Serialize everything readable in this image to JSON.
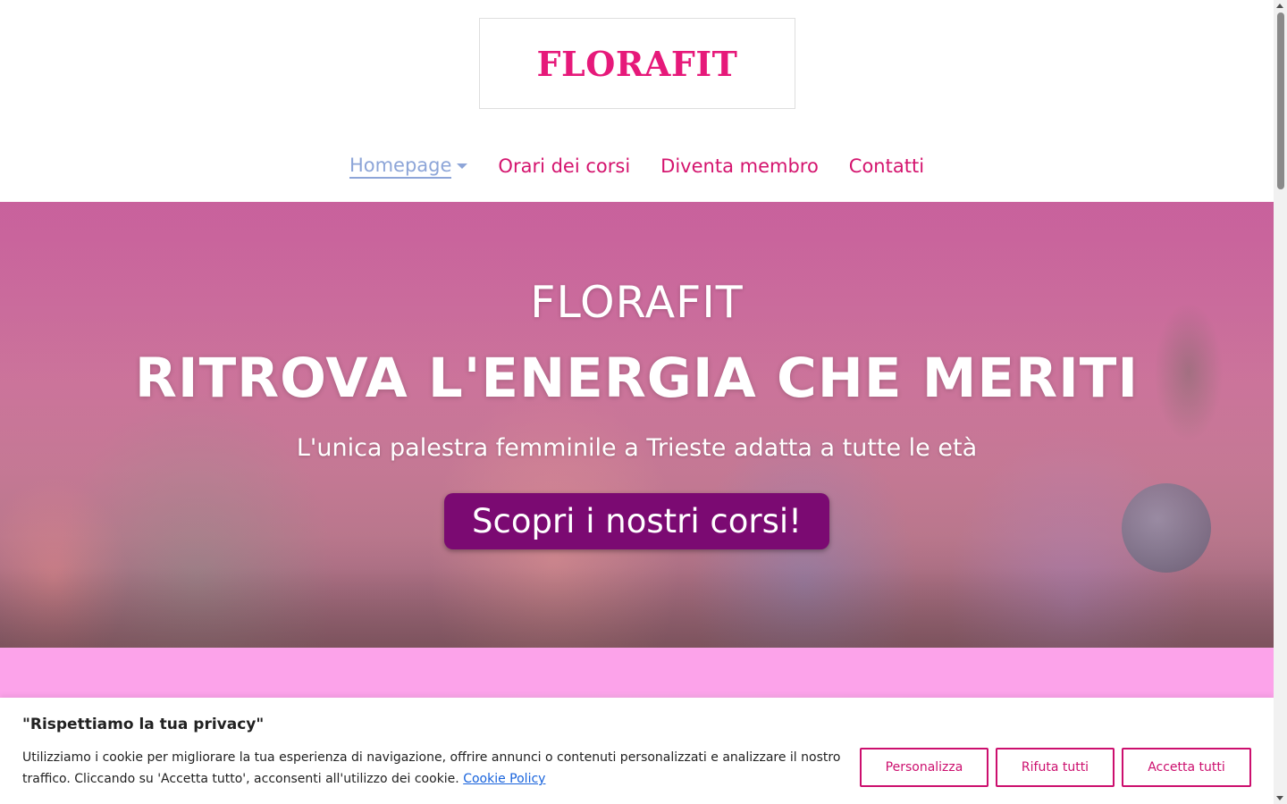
{
  "header": {
    "logo_text": "FLORAFIT"
  },
  "nav": {
    "items": [
      {
        "label": "Homepage",
        "active": true,
        "has_dropdown": true
      },
      {
        "label": "Orari dei corsi"
      },
      {
        "label": "Diventa membro"
      },
      {
        "label": "Contatti"
      }
    ]
  },
  "hero": {
    "title": "FLORAFIT",
    "headline": "RITROVA L'ENERGIA CHE MERITI",
    "subtitle": "L'unica palestra femminile a Trieste adatta a tutte le età",
    "cta_label": "Scopri i nostri corsi!"
  },
  "cookie_banner": {
    "title": "\"Rispettiamo la tua privacy\"",
    "text": "Utilizziamo i cookie per migliorare la tua esperienza di navigazione, offrire annunci o contenuti personalizzati e analizzare il nostro traffico. Cliccando su 'Accetta tutto', acconsenti all'utilizzo dei cookie.",
    "policy_link": "Cookie Policy",
    "buttons": {
      "customize": "Personalizza",
      "reject": "Rifuta tutti",
      "accept": "Accetta tutti"
    }
  },
  "colors": {
    "brand_pink": "#e6197a",
    "nav_pink": "#d4146e",
    "nav_active": "#8da5d8",
    "cta_purple": "#7b0a72",
    "band_pink": "#fca3ea",
    "cookie_accent": "#cc0f6e",
    "link_blue": "#1863dc"
  },
  "icons": {
    "nav_dropdown": "chevron-down-icon"
  }
}
